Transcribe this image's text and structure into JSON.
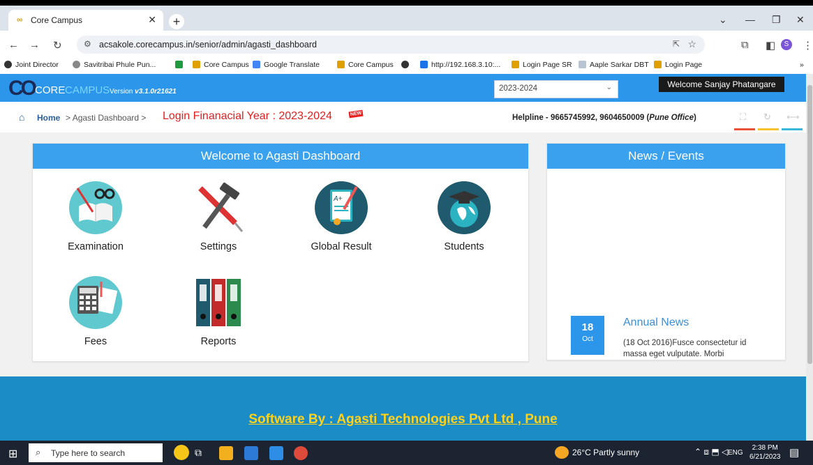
{
  "browser": {
    "tab_title": "Core Campus",
    "url": "acsakole.corecampus.in/senior/admin/agasti_dashboard",
    "bookmarks": [
      "Joint Director",
      "Savitribai Phule Pun...",
      "Core Campus",
      "Google Translate",
      "Core Campus",
      "http://192.168.3.10:...",
      "Login Page SR",
      "Aaple Sarkar DBT",
      "Login Page"
    ],
    "bookmark_overflow": "»"
  },
  "header": {
    "logo_co": "CO",
    "logo_core": "CORE",
    "logo_campus": "CAMPUS",
    "version_label": "Version",
    "version_value": "v3.1.0r21621",
    "year_select": "2023-2024",
    "welcome": "Welcome Sanjay Phatangare"
  },
  "breadcrumb": {
    "home": "Home",
    "sep": ">",
    "current": "Agasti Dashboard >",
    "login_fy": "Login Finanacial Year : 2023-2024",
    "new_badge": "NEW",
    "helpline": "Helpline - 9665745992, 9604650009 (",
    "helpline_office": "Pune Office",
    "helpline_end": ")"
  },
  "dashboard": {
    "title": "Welcome to Agasti Dashboard",
    "tiles": [
      {
        "label": "Examination",
        "icon": "book-glasses-icon"
      },
      {
        "label": "Settings",
        "icon": "hammer-screwdriver-icon"
      },
      {
        "label": "Global Result",
        "icon": "report-card-icon"
      },
      {
        "label": "Students",
        "icon": "graduation-globe-icon"
      },
      {
        "label": "Fees",
        "icon": "calculator-icon"
      },
      {
        "label": "Reports",
        "icon": "binders-icon"
      }
    ]
  },
  "news": {
    "title": "News / Events",
    "items": [
      {
        "day": "18",
        "month": "Oct",
        "title": "Annual News",
        "text": "(18 Oct 2016)Fusce consectetur id massa eget vulputate. Morbi"
      }
    ]
  },
  "footer": {
    "text": "Software By : Agasti Technologies Pvt Ltd , Pune"
  },
  "taskbar": {
    "search_placeholder": "Type here to search",
    "weather": "26°C  Partly sunny",
    "lang": "ENG",
    "time": "2:38 PM",
    "date": "6/21/2023"
  },
  "colors": {
    "header_blue": "#2c97ea",
    "panel_blue": "#3aa1ef",
    "footer_blue": "#1b8cc5",
    "footer_text": "#ffd21a",
    "alert_red": "#e02020"
  }
}
